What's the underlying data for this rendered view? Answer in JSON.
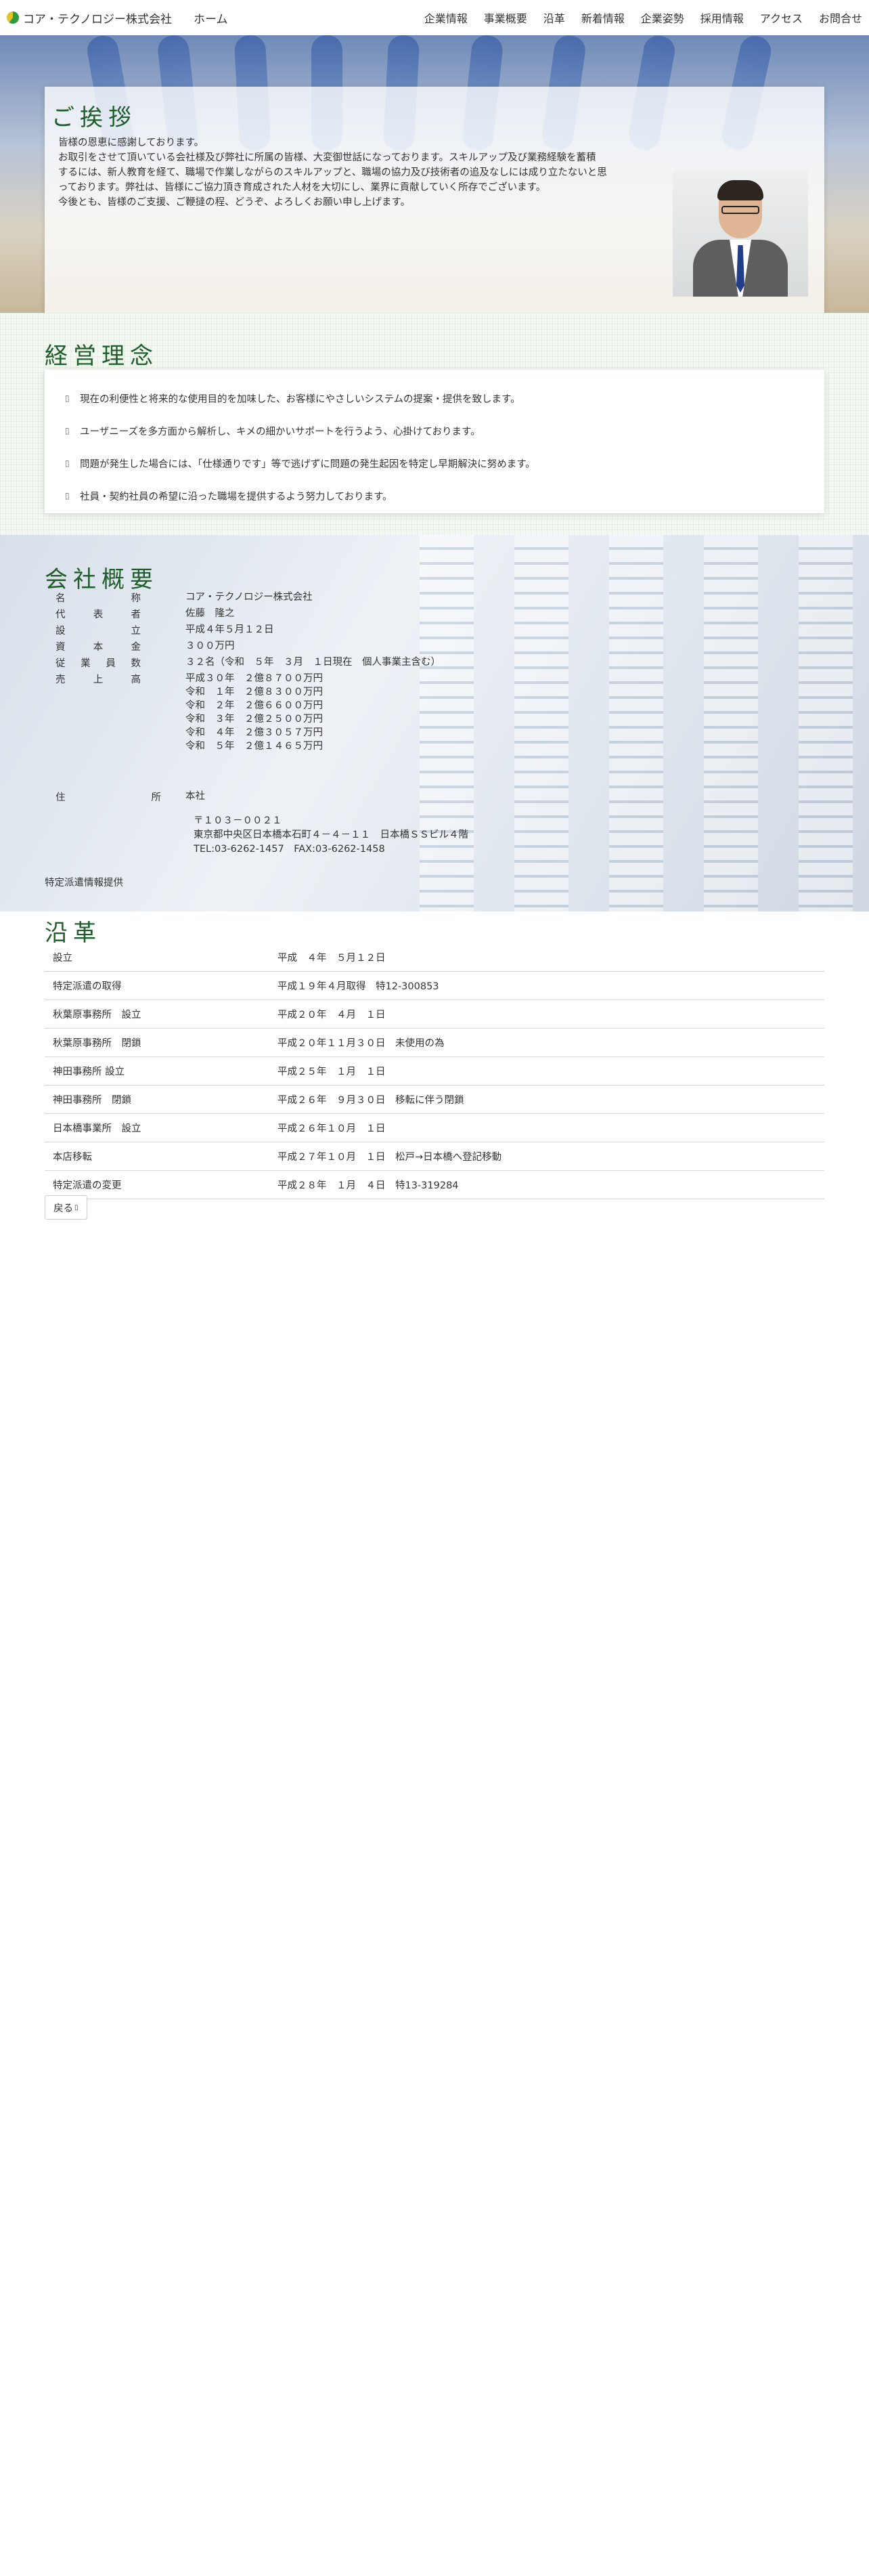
{
  "nav": {
    "brand": "コア・テクノロジー株式会社",
    "home": "ホーム",
    "items": [
      "企業情報",
      "事業概要",
      "沿革",
      "新着情報",
      "企業姿勢",
      "採用情報",
      "アクセス",
      "お問合せ"
    ]
  },
  "greeting": {
    "title": "ご挨拶",
    "lines": [
      "皆様の恩恵に感謝しております。",
      "お取引をさせて頂いている会社様及び弊社に所属の皆様、大変御世話になっております。スキルアップ及び業務経験を蓄積",
      "するには、新人教育を経て、職場で作業しながらのスキルアップと、職場の協力及び技術者の追及なしには成り立たないと思",
      "っております。弊社は、皆様にご協力頂き育成された人材を大切にし、業界に貢献していく所存でございます。",
      "今後とも、皆様のご支援、ご鞭撻の程、どうぞ、よろしくお願い申し上げます。"
    ]
  },
  "philosophy": {
    "title": "経営理念",
    "items": [
      "現在の利便性と将来的な使用目的を加味した、お客様にやさしいシステムの提案・提供を致します。",
      "ユーザニーズを多方面から解析し、キメの細かいサポートを行うよう、心掛けております。",
      "問題が発生した場合には、「仕様通りです」等で逃げずに問題の発生起因を特定し早期解決に努めます。",
      "社員・契約社員の希望に沿った職場を提供するよう努力しております。"
    ]
  },
  "overview": {
    "title": "会社概要",
    "rows": [
      {
        "label": [
          "名",
          "称"
        ],
        "value": [
          "コア・テクノロジー株式会社"
        ]
      },
      {
        "label": [
          "代",
          "表",
          "者"
        ],
        "value": [
          "佐藤　隆之"
        ]
      },
      {
        "label": [
          "設",
          "立"
        ],
        "value": [
          "平成４年５月１２日"
        ]
      },
      {
        "label": [
          "資",
          "本",
          "金"
        ],
        "value": [
          "３００万円"
        ]
      },
      {
        "label": [
          "従",
          "業",
          "員",
          "数"
        ],
        "value": [
          "３２名（令和　５年　３月　１日現在　個人事業主含む）"
        ]
      },
      {
        "label": [
          "売",
          "上",
          "高"
        ],
        "value": [
          "平成３０年　２億８７００万円",
          "令和　１年　２億８３００万円",
          "令和　２年　２億６６００万円",
          "令和　３年　２億２５００万円",
          "令和　４年　２億３０５７万円",
          "令和　５年　２億１４６５万円"
        ]
      },
      {
        "label": [
          "住",
          "所"
        ],
        "value": [
          "本社"
        ]
      }
    ],
    "address": [
      "〒１０３－００２１",
      "東京都中央区日本橋本石町４－４－１１　日本橋ＳＳビル４階",
      "TEL:03-6262-1457　FAX:03-6262-1458"
    ],
    "note": "特定派遣情報提供"
  },
  "history": {
    "title": "沿革",
    "rows": [
      [
        "設立",
        "平成　４年　５月１２日"
      ],
      [
        "特定派遣の取得",
        "平成１９年４月取得　特12-300853"
      ],
      [
        "秋葉原事務所　設立",
        "平成２０年　４月　１日"
      ],
      [
        "秋葉原事務所　閉鎖",
        "平成２０年１１月３０日　未使用の為"
      ],
      [
        "神田事務所 設立",
        "平成２５年　１月　１日"
      ],
      [
        "神田事務所　閉鎖",
        "平成２６年　９月３０日　移転に伴う閉鎖"
      ],
      [
        "日本橋事業所　設立",
        "平成２６年１０月　１日"
      ],
      [
        "本店移転",
        "平成２７年１０月　１日　松戸→日本橋へ登記移動"
      ],
      [
        "特定派遣の変更",
        "平成２８年　１月　４日　特13-319284"
      ]
    ],
    "back": "戻る"
  }
}
